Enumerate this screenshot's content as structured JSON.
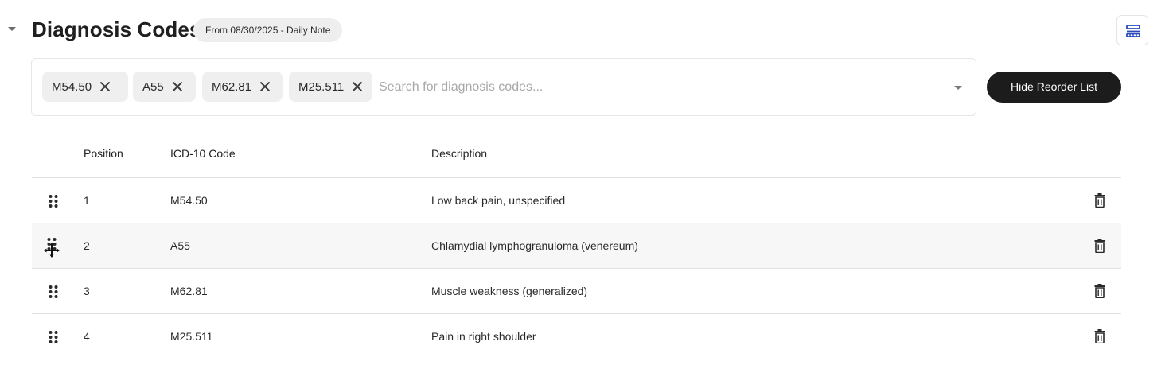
{
  "header": {
    "title": "Diagnosis Codes",
    "source_badge": "From 08/30/2025 - Daily Note"
  },
  "selector": {
    "chips": [
      {
        "label": "M54.50"
      },
      {
        "label": "A55"
      },
      {
        "label": "M62.81"
      },
      {
        "label": "M25.511"
      }
    ],
    "search_placeholder": "Search for diagnosis codes...",
    "search_value": ""
  },
  "hide_reorder_button": {
    "label": "Hide Reorder List"
  },
  "table": {
    "columns": {
      "position": "Position",
      "code": "ICD-10 Code",
      "description": "Description"
    },
    "rows": [
      {
        "position": "1",
        "code": "M54.50",
        "description": "Low back pain, unspecified"
      },
      {
        "position": "2",
        "code": "A55",
        "description": "Chlamydial lymphogranuloma (venereum)"
      },
      {
        "position": "3",
        "code": "M62.81",
        "description": "Muscle weakness (generalized)"
      },
      {
        "position": "4",
        "code": "M25.511",
        "description": "Pain in right shoulder"
      }
    ]
  },
  "icons": {
    "collapse": "chevron-down-icon",
    "settings": "list-settings-icon",
    "chip_remove": "close-icon",
    "dropdown": "chevron-down-icon",
    "drag": "drag-handle-icon",
    "delete": "trash-icon"
  },
  "colors": {
    "primary_button": "#1c1c1c",
    "chip_background": "#efefef",
    "badge_background": "#eeeeee",
    "row_hover": "#f7f7f7"
  }
}
